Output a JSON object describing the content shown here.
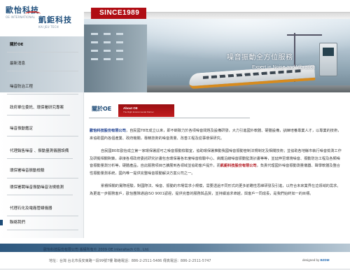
{
  "logo": {
    "name_line1": "歐怡科技",
    "name_line2": "凱鉅科技",
    "en_line1": "OE INTERNATIONAL",
    "en_line2": "KAI JEU TECH"
  },
  "header": {
    "since": "SINCE1989",
    "banner_title_cn": "噪音振動全方位服務",
    "banner_title_en": "Expert in Noise and Vibration"
  },
  "sidebar": {
    "items": [
      {
        "label": "關於OE"
      },
      {
        "label": "最新消息"
      },
      {
        "label": "噪音防治工程"
      },
      {
        "label": "政府單位委託、環保署研究專案"
      },
      {
        "label": "噪音振動鑑定"
      },
      {
        "label": "代理銷售噪音 、振動量測儀器設備"
      },
      {
        "label": "環保署噪音振動檢驗"
      },
      {
        "label": "環保署聘噪音振動噪音法規檢測"
      },
      {
        "label": "代理石化及電廠管線儀器"
      },
      {
        "label": "聯絡我們"
      }
    ]
  },
  "main": {
    "tab_cn": "關於OE",
    "tab_en": "About OE",
    "tab_en_sub": "The Right Environmental Partner",
    "paragraphs": {
      "p1_brand": "歐怡科技股份有限公司",
      "p1_text": "，自民國78年成立以來，即不斷致力於各項噪音問題及設備研發，大力引進國外軟體、硬體設備，訓練培養專業人才，以專業的技術，來協助國內各個產業、政府機關，專精技術的噪音測量、改善工程及從事環保研究。",
      "p2_text_a": "自民國80年歐怡成立第一家環保署認可之噪音振動檢驗室，協助環保署推動我國噪音振動管制法規制定及相關技術；並協助各地縣市執行噪音檢測工作及研擬相關對策，承接各項政府委託研究計畫包含環保署各年度噪音檢驗中心、高鐵沿線噪音振動監測計畫等等，並延伸至環境噪音、振動防治工程及各類噪音振動量測分析等，硬體產品，自此服務項目已擴展到各領域並協助客戶提升，而",
      "p2_brand": "凱鉅科技股份有限公司",
      "p2_text_b": "，負責代理國外噪音振動測量儀器、聲學軟體及整合性振動量測系統，國內唯一提供完整噪音振動解決方案公司之一。",
      "p3_text": "累積相關的實際經驗，對國際法、噪音、振動的市場需求小規模，需要透過不同形式的更多前瞻性思維研發及引進，以符合未來業界在這領域的需求。為更進一步服務客戶，歐怡團隊通過ISO 9001認證，提供完善的服務與品質，並持續追求卓越，與客戶一同成長，是我們始終如一的目標。"
    }
  },
  "footer": {
    "copyright": "歐怡科技股份有限公司 版權所有© 2009 OE interaltech CO., Ltd.",
    "address": "地址：台灣 台北市長安東路一段99號7樓 聯絡電話：886-2-2511-5486 傳真電話：886-2-2511-5747",
    "designer_prefix": "designed by",
    "designer_name": "BZDM"
  },
  "colors": {
    "accent_red": "#b00d14",
    "brand_blue": "#1d4a76",
    "footer_band": "#2d587f"
  }
}
